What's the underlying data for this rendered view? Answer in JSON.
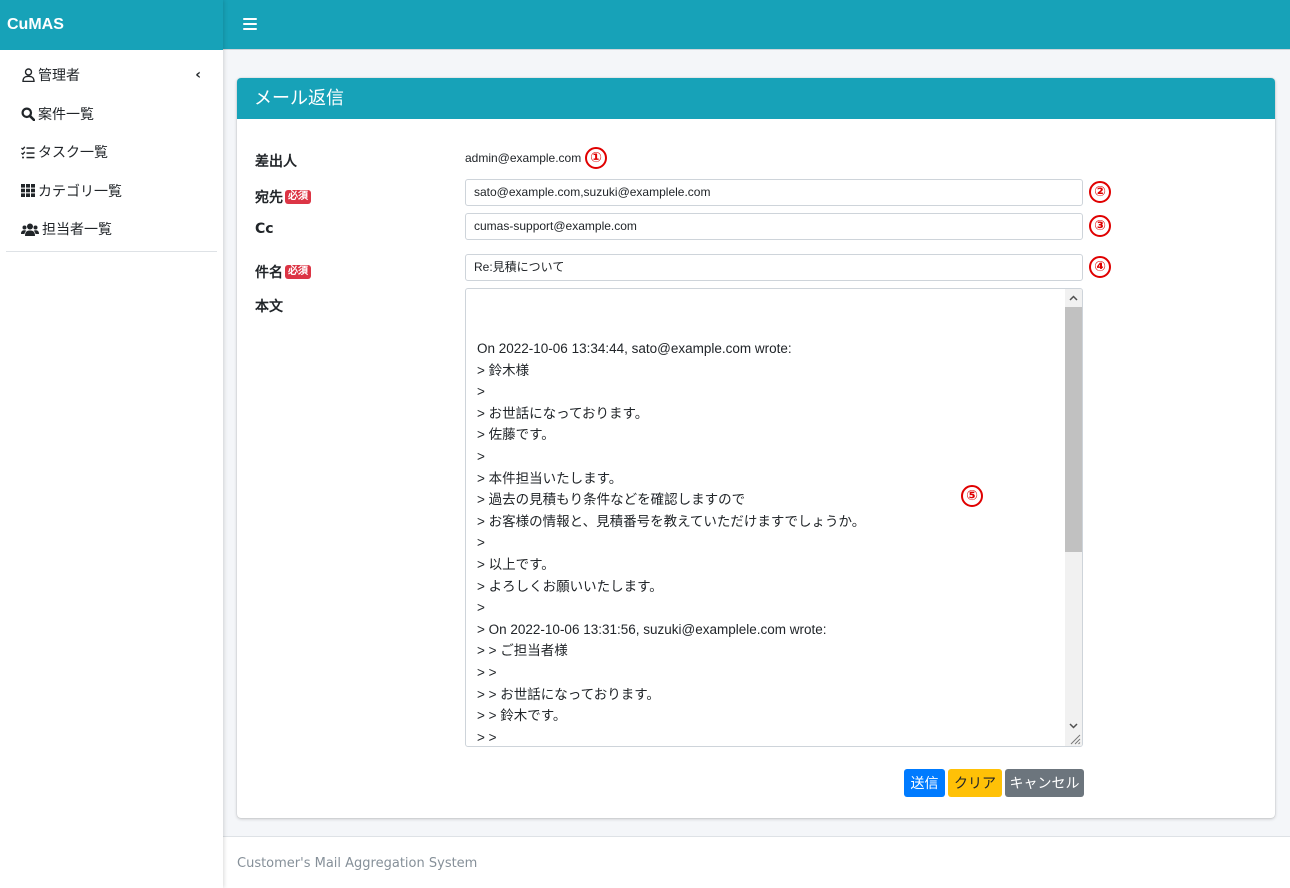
{
  "brand": "CuMAS",
  "sidebar": {
    "items": [
      {
        "icon": "user-icon",
        "label": "管理者",
        "has_chevron": true,
        "chevron": "‹"
      },
      {
        "icon": "search-icon",
        "label": "案件一覧"
      },
      {
        "icon": "task-list-icon",
        "label": "タスク一覧"
      },
      {
        "icon": "grid-icon",
        "label": "カテゴリ一覧"
      },
      {
        "icon": "users-icon",
        "label": "担当者一覧"
      }
    ]
  },
  "colors": {
    "primary": "#17a2b8",
    "required_badge": "#dc3545",
    "send": "#007bff",
    "clear": "#ffc107",
    "cancel": "#6c757d",
    "annotation": "#e00000"
  },
  "card": {
    "title": "メール返信"
  },
  "form": {
    "from_label": "差出人",
    "from_value": "admin@example.com",
    "to_label": "宛先",
    "to_value": "sato@example.com,suzuki@examplele.com",
    "cc_label": "Cc",
    "cc_value": "cumas-support@example.com",
    "subject_label": "件名",
    "subject_value": "Re:見積について",
    "body_label": "本文",
    "required_badge": "必須",
    "body_text": "On 2022-10-06 13:34:44, sato@example.com wrote:\n> 鈴木様\n>\n> お世話になっております。\n> 佐藤です。\n>\n> 本件担当いたします。\n> 過去の見積もり条件などを確認しますので\n> お客様の情報と、見積番号を教えていただけますでしょうか。\n>\n> 以上です。\n> よろしくお願いいたします。\n>\n> On 2022-10-06 13:31:56, suzuki@examplele.com wrote:\n> > ご担当者様\n> >\n> > お世話になっております。\n> > 鈴木です。\n> >"
  },
  "annotations": [
    "①",
    "②",
    "③",
    "④",
    "⑤"
  ],
  "buttons": {
    "send": "送信",
    "clear": "クリア",
    "cancel": "キャンセル"
  },
  "footer": {
    "text": "Customer's Mail Aggregation System"
  }
}
